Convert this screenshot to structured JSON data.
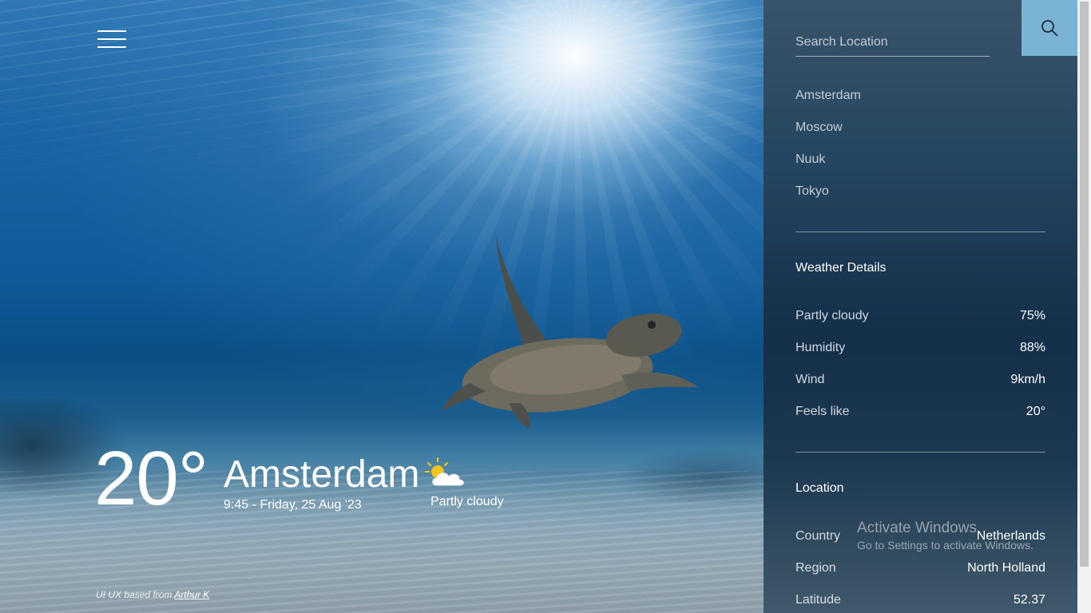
{
  "current": {
    "temperature": "20°",
    "city": "Amsterdam",
    "datetime": "9:45 - Friday, 25 Aug '23",
    "condition": "Partly cloudy",
    "condition_icon": "partly-cloudy-icon"
  },
  "credit": {
    "prefix": "UI UX based from",
    "author": "Arthur K"
  },
  "search": {
    "placeholder": "Search Location",
    "icon": "search-icon"
  },
  "cities": [
    "Amsterdam",
    "Moscow",
    "Nuuk",
    "Tokyo"
  ],
  "weather_details": {
    "title": "Weather Details",
    "rows": [
      {
        "label": "Partly cloudy",
        "value": "75%"
      },
      {
        "label": "Humidity",
        "value": "88%"
      },
      {
        "label": "Wind",
        "value": "9km/h"
      },
      {
        "label": "Feels like",
        "value": "20°"
      }
    ]
  },
  "location": {
    "title": "Location",
    "rows": [
      {
        "label": "Country",
        "value": "Netherlands"
      },
      {
        "label": "Region",
        "value": "North Holland"
      },
      {
        "label": "Latitude",
        "value": "52.37"
      }
    ]
  },
  "watermark": {
    "line1": "Activate Windows",
    "line2": "Go to Settings to activate Windows."
  },
  "colors": {
    "search_button": "#7bb3d4"
  }
}
